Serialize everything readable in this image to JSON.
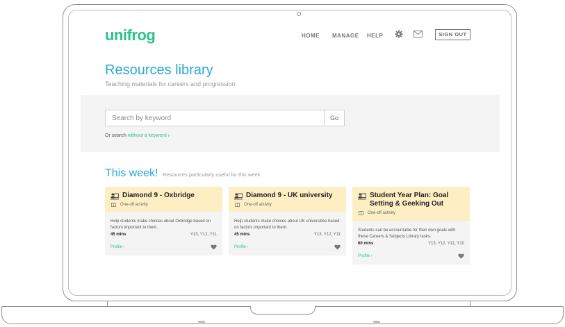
{
  "nav": {
    "logo": "unifrog",
    "links": [
      "HOME",
      "MANAGE",
      "HELP"
    ],
    "sign_out": "SIGN OUT"
  },
  "page": {
    "title": "Resources library",
    "subtitle": "Teaching materials for careers and progression"
  },
  "search": {
    "placeholder": "Search by keyword",
    "go_label": "Go",
    "or_prefix": "Or search ",
    "or_link": "without a keyword",
    "or_chevron": "›"
  },
  "week": {
    "title": "This week!",
    "subtitle": "Resources particularly useful for this week"
  },
  "cards": [
    {
      "title": "Diamond 9 - Oxbridge",
      "type": "One-off activity",
      "description": "Help students make choices about Oxbridge based on factors important to them.",
      "mins": "45 mins",
      "years": "Y13, Y12, Y11",
      "profile": "Profile ›"
    },
    {
      "title": "Diamond 9 - UK university",
      "type": "One-off activity",
      "description": "Help students make choices about UK universities based on factors important to them.",
      "mins": "45 mins",
      "years": "Y13, Y12, Y11",
      "profile": "Profile ›"
    },
    {
      "title": "Student Year Plan: Goal Setting & Geeking Out",
      "type": "One-off activity",
      "description": "Students can be accountable for their own goals with these Careers & Subjects Library tasks.",
      "mins": "60 mins",
      "years": "Y13, Y12, Y11, Y10",
      "profile": "Profile ›"
    }
  ],
  "icons": {
    "settings": "gear-icon",
    "messages": "mail-icon",
    "task": "task-icon",
    "activity": "book-icon",
    "favourite": "heart-icon"
  },
  "colors": {
    "brand_green": "#2ec18a",
    "title_blue": "#2aa9d8",
    "card_header": "#fdeec3",
    "band_grey": "#f4f4f4"
  }
}
